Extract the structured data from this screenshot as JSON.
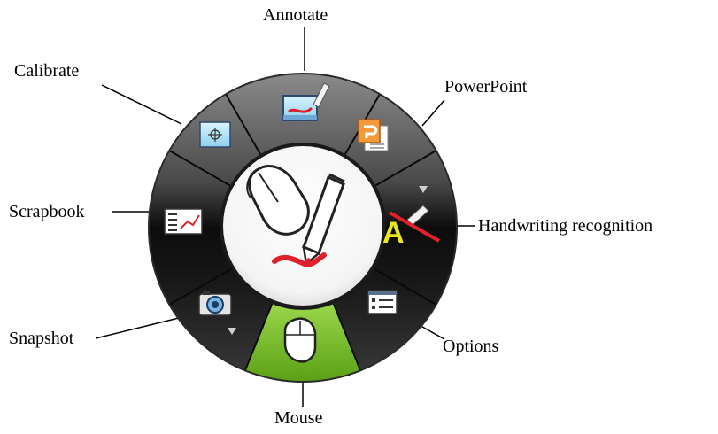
{
  "menu": {
    "center": {
      "icon": "mouse-and-pen-icon"
    },
    "items": [
      {
        "id": "annotate",
        "label": "Annotate",
        "icon": "annotate-icon"
      },
      {
        "id": "powerpoint",
        "label": "PowerPoint",
        "icon": "powerpoint-icon"
      },
      {
        "id": "handwriting",
        "label": "Handwriting recognition",
        "icon": "handwriting-recognition-icon",
        "has_dropdown": true
      },
      {
        "id": "options",
        "label": "Options",
        "icon": "options-icon"
      },
      {
        "id": "mouse",
        "label": "Mouse",
        "icon": "mouse-icon",
        "selected": true
      },
      {
        "id": "snapshot",
        "label": "Snapshot",
        "icon": "camera-icon",
        "has_dropdown": true
      },
      {
        "id": "scrapbook",
        "label": "Scrapbook",
        "icon": "scrapbook-icon"
      },
      {
        "id": "calibrate",
        "label": "Calibrate",
        "icon": "calibrate-icon"
      }
    ]
  },
  "colors": {
    "selected_segment": "#7cc22a",
    "ring_dark": "#101010",
    "ring_light": "#6a6a6a",
    "pen_red": "#e0202a"
  }
}
